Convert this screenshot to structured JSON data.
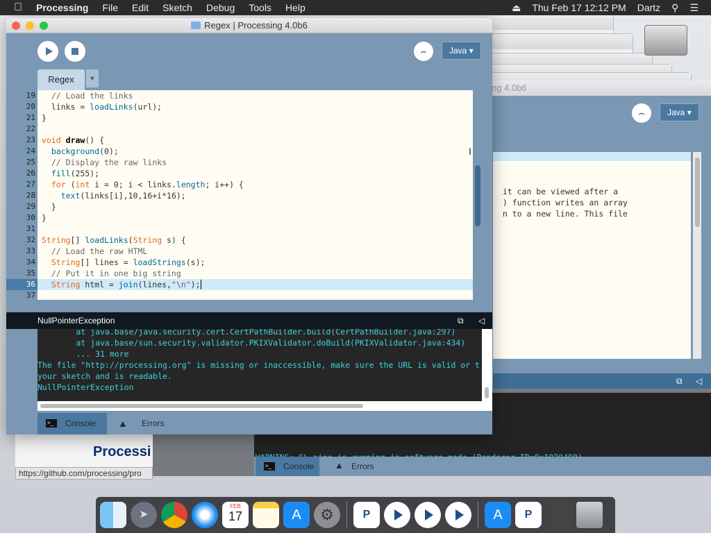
{
  "menubar": {
    "items": [
      "Processing",
      "File",
      "Edit",
      "Sketch",
      "Debug",
      "Tools",
      "Help"
    ],
    "clock": "Thu Feb 17  12:12 PM",
    "user": "Dartz"
  },
  "main_window": {
    "title": "Regex | Processing 4.0b6",
    "mode": "Java",
    "tab": "Regex",
    "line_numbers": [
      "19",
      "20",
      "21",
      "22",
      "23",
      "24",
      "25",
      "26",
      "27",
      "28",
      "29",
      "30",
      "31",
      "32",
      "33",
      "34",
      "35",
      "36",
      "37"
    ],
    "highlighted_line": "36",
    "error_title": "NullPointerException",
    "console": {
      "l1": "        at java.base/java.security.cert.CertPathBuilder.build(CertPathBuilder.java:297)",
      "l2": "        at java.base/sun.security.validator.PKIXValidator.doBuild(PKIXValidator.java:434)",
      "l3": "        ... 31 more",
      "l4": "The file \"http://processing.org\" is missing or inaccessible, make sure the URL is valid or t",
      "l5": "your sketch and is readable.",
      "l6": "NullPointerException"
    },
    "tabs": {
      "console": "Console",
      "errors": "Errors"
    }
  },
  "back_window": {
    "title": "Processing 4.0b6",
    "title_fragment": "ng 4.0b6",
    "mode": "Java",
    "snippet": [
      "  it can be viewed after a",
      "  ) function writes an array",
      "  n to a new line. This file"
    ]
  },
  "bottom_window": {
    "warning": "WARNING: GL pipe is running in software mode (Renderer ID=0x1020400)",
    "tabs": {
      "console": "Console",
      "errors": "Errors"
    }
  },
  "web_fragment": "Processi",
  "status_url": "https://github.com/processing/pro",
  "dock": {
    "calendar_month": "FEB",
    "calendar_day": "17"
  },
  "colors": {
    "processing_blue": "#7a97b3",
    "editor_bg": "#fffdf3",
    "console_text": "#3fd0e0",
    "console_bg": "#262626"
  }
}
